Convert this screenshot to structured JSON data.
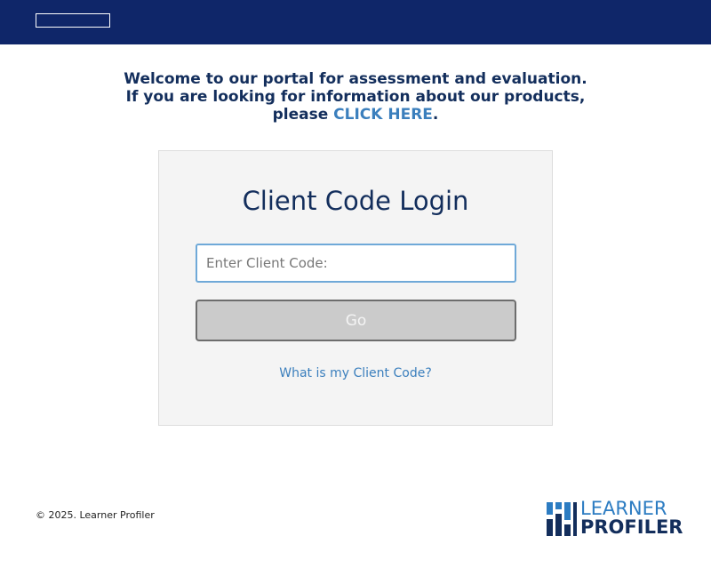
{
  "header": {
    "logo_alt": ""
  },
  "welcome": {
    "line1": "Welcome to our portal for assessment and evaluation.",
    "line2": "If you are looking for information about our products,",
    "line3_prefix": "please ",
    "link_text": "CLICK HERE",
    "line3_suffix": "."
  },
  "login": {
    "title": "Client Code Login",
    "input_placeholder": "Enter Client Code:",
    "input_value": "",
    "button_label": "Go",
    "help_link": "What is my Client Code?"
  },
  "footer": {
    "copyright": "© 2025. Learner Profiler",
    "brand_line1": "LEARNER",
    "brand_line2": "PROFILER"
  },
  "colors": {
    "header_bg": "#0f2669",
    "heading_text": "#132e5c",
    "link": "#3b7fbd",
    "button_bg": "#cbcbcb",
    "brand_blue": "#2c7cc2"
  }
}
